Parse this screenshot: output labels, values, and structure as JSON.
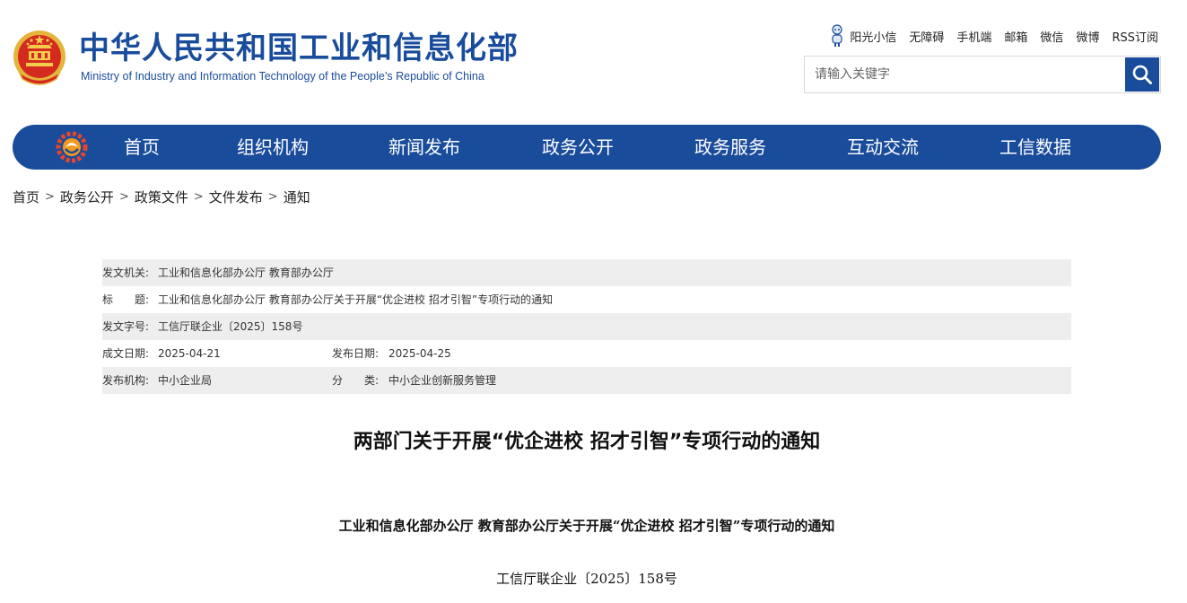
{
  "header": {
    "title": "中华人民共和国工业和信息化部",
    "subtitle": "Ministry of Industry and Information Technology of the People’s Republic of China"
  },
  "toplinks": [
    "阳光小信",
    "无障碍",
    "手机端",
    "邮箱",
    "微信",
    "微博",
    "RSS订阅"
  ],
  "search": {
    "placeholder": "请输入关键字"
  },
  "nav": [
    "首页",
    "组织机构",
    "新闻发布",
    "政务公开",
    "政务服务",
    "互动交流",
    "工信数据"
  ],
  "breadcrumb": [
    "首页",
    "政务公开",
    "政策文件",
    "文件发布",
    "通知"
  ],
  "info": {
    "issuer_label": "发文机关:",
    "issuer": "工业和信息化部办公厅 教育部办公厅",
    "title_label": "标　　题:",
    "title": "工业和信息化部办公厅 教育部办公厅关于开展“优企进校 招才引智”专项行动的通知",
    "docno_label": "发文字号:",
    "docno": "工信厅联企业〔2025〕158号",
    "created_label": "成文日期:",
    "created": "2025-04-21",
    "published_label": "发布日期:",
    "published": "2025-04-25",
    "org_label": "发布机构:",
    "org": "中小企业局",
    "category_label": "分　　类:",
    "category": "中小企业创新服务管理"
  },
  "article": {
    "title": "两部门关于开展“优企进校 招才引智”专项行动的通知",
    "sub_heading": "工业和信息化部办公厅  教育部办公厅关于开展“优企进校  招才引智”专项行动的通知",
    "doc_number": "工信厅联企业〔2025〕158号"
  },
  "colors": {
    "brand_blue": "#1a4c9c",
    "table_grey": "#eeeeee"
  }
}
